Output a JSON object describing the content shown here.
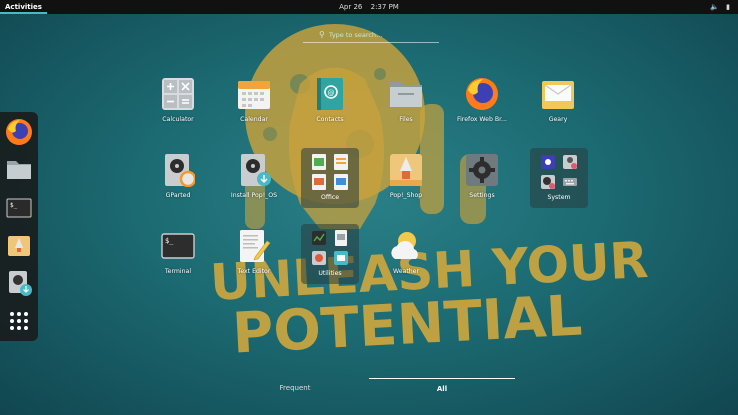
{
  "topbar": {
    "activities": "Activities",
    "date": "Apr 26",
    "time": "2:37 PM",
    "tray": {
      "volume_icon": "volume-icon",
      "battery_icon": "battery-icon"
    }
  },
  "search": {
    "placeholder": "Type to search…"
  },
  "dash": {
    "items": [
      {
        "name": "firefox"
      },
      {
        "name": "files"
      },
      {
        "name": "terminal"
      },
      {
        "name": "pop-shop"
      },
      {
        "name": "install-pop-os"
      },
      {
        "name": "show-applications"
      }
    ]
  },
  "apps": {
    "calculator": "Calculator",
    "calendar": "Calendar",
    "contacts": "Contacts",
    "files": "Files",
    "firefox": "Firefox Web Br...",
    "geary": "Geary",
    "gparted": "GParted",
    "install": "Install Pop!_OS",
    "office": "Office",
    "popshop": "Pop!_Shop",
    "settings": "Settings",
    "system": "System",
    "terminal": "Terminal",
    "texteditor": "Text Editor",
    "utilities": "Utilities",
    "weather": "Weather"
  },
  "view_toggle": {
    "frequent": "Frequent",
    "all": "All"
  },
  "wallpaper": {
    "line1": "UNLEASH YOUR",
    "line2": "POTENTIAL"
  },
  "colors": {
    "accent": "#48b9c7",
    "wallpaper_teal": "#1c6a72",
    "wallpaper_gold": "#c9a23c"
  }
}
